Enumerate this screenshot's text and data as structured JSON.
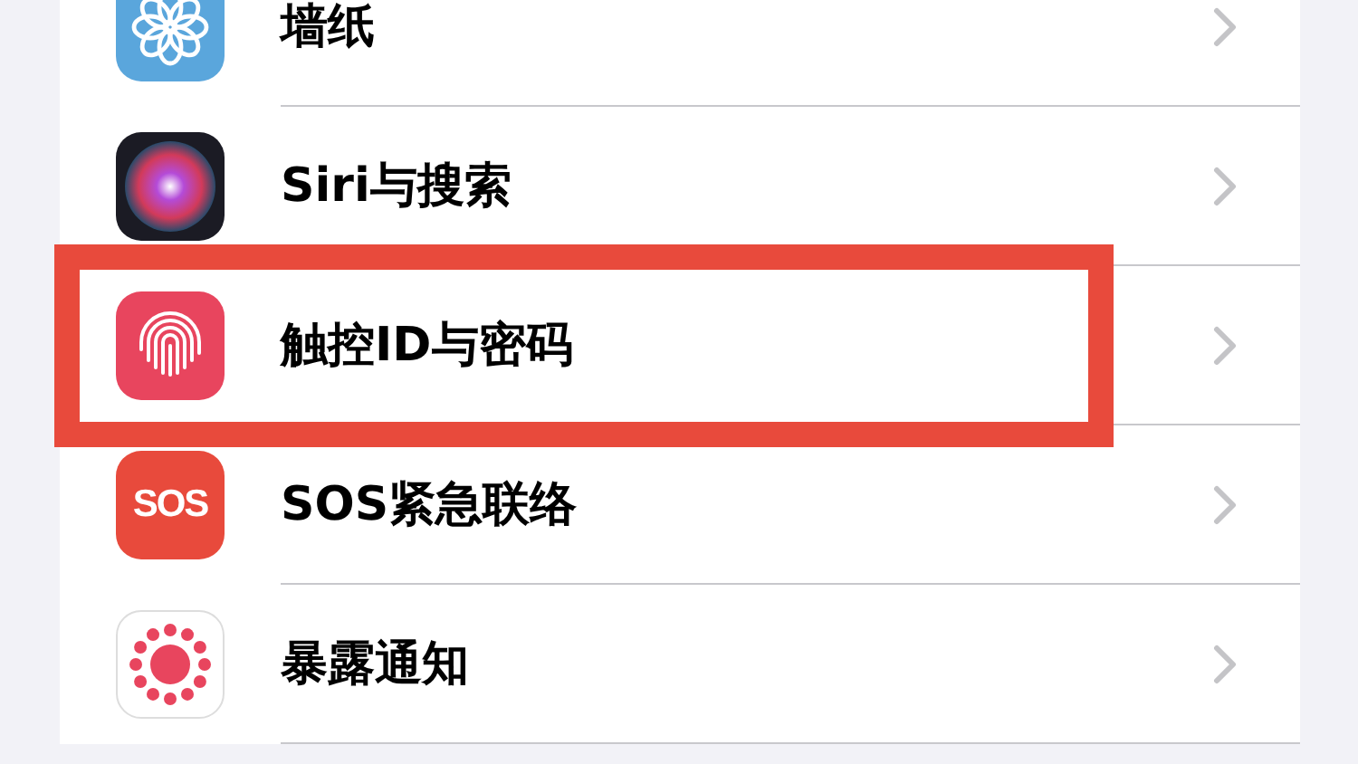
{
  "settings_items": [
    {
      "label": "墙纸",
      "kind": "flower",
      "highlighted": false
    },
    {
      "label": "Siri与搜索",
      "kind": "orb",
      "highlighted": false
    },
    {
      "label": "触控ID与密码",
      "kind": "fingerprint",
      "highlighted": true
    },
    {
      "label": "SOS紧急联络",
      "kind": "sos",
      "icon_text": "SOS",
      "highlighted": false
    },
    {
      "label": "暴露通知",
      "kind": "dots",
      "highlighted": false
    }
  ]
}
